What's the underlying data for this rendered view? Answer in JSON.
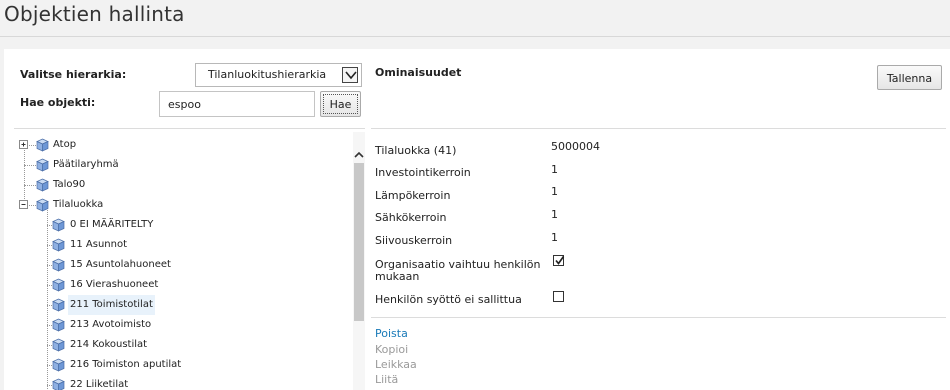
{
  "page": {
    "title": "Objektien hallinta"
  },
  "hierarchy": {
    "label": "Valitse hierarkia:",
    "selected": "Tilanluokitushierarkia"
  },
  "search": {
    "label": "Hae objekti:",
    "value": "espoo",
    "button_label": "Hae"
  },
  "tree": {
    "nodes": [
      {
        "label": "Atop",
        "expander": "plus"
      },
      {
        "label": "Päätilaryhmä"
      },
      {
        "label": "Talo90"
      },
      {
        "label": "Tilaluokka",
        "expander": "minus"
      },
      {
        "label": "0 EI MÄÄRITELTY"
      },
      {
        "label": "11 Asunnot"
      },
      {
        "label": "15 Asuntolahuoneet"
      },
      {
        "label": "16 Vierashuoneet"
      },
      {
        "label": "211 Toimistotilat",
        "selected": true
      },
      {
        "label": "213 Avotoimisto"
      },
      {
        "label": "214 Kokoustilat"
      },
      {
        "label": "216 Toimiston aputilat"
      },
      {
        "label": "22 Liiketilat"
      }
    ]
  },
  "properties": {
    "title": "Ominaisuudet",
    "save_label": "Tallenna",
    "rows": [
      {
        "label": "Tilaluokka (41)",
        "value": "5000004"
      },
      {
        "label": "Investointikerroin",
        "value": "1"
      },
      {
        "label": "Lämpökerroin",
        "value": "1"
      },
      {
        "label": "Sähkökerroin",
        "value": "1"
      },
      {
        "label": "Siivouskerroin",
        "value": "1"
      },
      {
        "label_line1": "Organisaatio vaihtuu henkilön",
        "label_line2": "mukaan",
        "checked": true
      },
      {
        "label": "Henkilön syöttö ei sallittua",
        "checked": false
      }
    ]
  },
  "actions": [
    {
      "label": "Poista",
      "state": "active"
    },
    {
      "label": "Kopioi",
      "state": "disabled"
    },
    {
      "label": "Leikkaa",
      "state": "disabled"
    },
    {
      "label": "Liitä",
      "state": "disabled"
    }
  ],
  "colors": {
    "link": "#1a7ab8",
    "disabled": "#9a9a9a",
    "cube_top": "#c9dbf3",
    "cube_front": "#6d97d6"
  }
}
